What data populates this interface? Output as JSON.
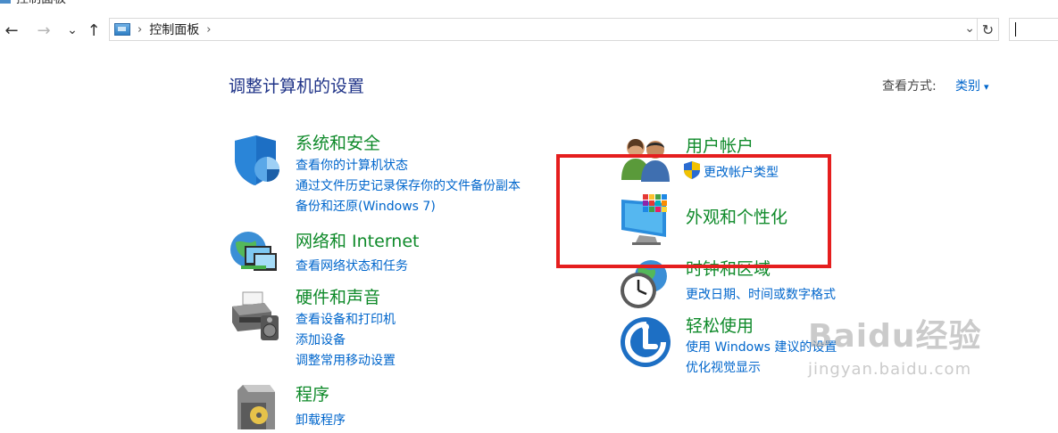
{
  "window": {
    "title_fragment": "控制面板"
  },
  "nav": {
    "back_glyph": "←",
    "forward_glyph": "→",
    "recent_glyph": "⌄",
    "up_glyph": "↑",
    "breadcrumb": [
      "控制面板"
    ],
    "breadcrumb_sep": "›",
    "dropdown_glyph": "⌄",
    "refresh_glyph": "↻"
  },
  "header": {
    "title": "调整计算机的设置",
    "view_label": "查看方式:",
    "view_value": "类别"
  },
  "categories_left": [
    {
      "title": "系统和安全",
      "icon": "shield-icon",
      "links": [
        "查看你的计算机状态",
        "通过文件历史记录保存你的文件备份副本",
        "备份和还原(Windows 7)"
      ]
    },
    {
      "title": "网络和 Internet",
      "icon": "network-icon",
      "links": [
        "查看网络状态和任务"
      ]
    },
    {
      "title": "硬件和声音",
      "icon": "printer-icon",
      "links": [
        "查看设备和打印机",
        "添加设备",
        "调整常用移动设置"
      ]
    },
    {
      "title": "程序",
      "icon": "programs-icon",
      "links": [
        "卸载程序"
      ]
    }
  ],
  "categories_right": [
    {
      "title": "用户帐户",
      "icon": "users-icon",
      "links": [
        "更改帐户类型"
      ]
    },
    {
      "title": "外观和个性化",
      "icon": "monitor-icon",
      "links": []
    },
    {
      "title": "时钟和区域",
      "icon": "clock-icon",
      "links": [
        "更改日期、时间或数字格式"
      ]
    },
    {
      "title": "轻松使用",
      "icon": "accessibility-icon",
      "links": [
        "使用 Windows 建议的设置",
        "优化视觉显示"
      ]
    }
  ],
  "watermark": {
    "brand": "Baidu经验",
    "url": "jingyan.baidu.com"
  },
  "colors": {
    "category_title": "#0f8a2a",
    "link": "#0066cc",
    "page_title": "#1e3287",
    "highlight": "#e51e1e"
  }
}
